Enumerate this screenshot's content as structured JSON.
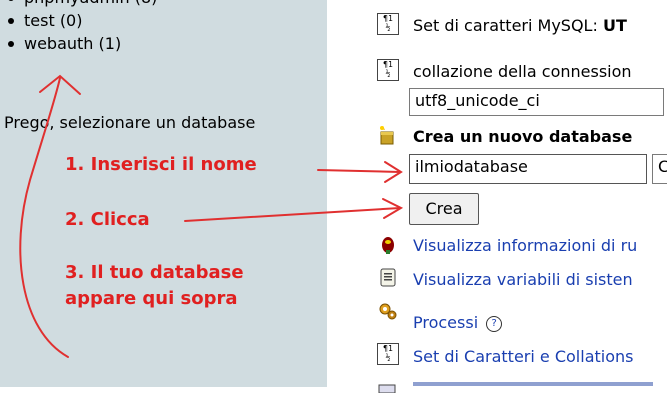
{
  "left_panel": {
    "databases": [
      {
        "name": "phpmyadmin (8)"
      },
      {
        "name": "test (0)"
      },
      {
        "name": "webauth (1)"
      }
    ],
    "prompt": "Prego, selezionare un database"
  },
  "annotations": {
    "step1": "1. Inserisci il nome",
    "step2": "2. Clicca",
    "step3_line1": "3. Il tuo database",
    "step3_line2": "appare qui sopra",
    "color": "#e02020"
  },
  "right_panel": {
    "charset_label": "Set di caratteri MySQL: ",
    "charset_value": "UT",
    "collation_label": "collazione della connession",
    "collation_value": "utf8_unicode_ci",
    "create_db_title": "Crea un nuovo database",
    "db_name_value": "ilmiodatabase",
    "collation_stub": "C",
    "create_button": "Crea",
    "links": {
      "server_info": "Visualizza informazioni di ru",
      "system_vars": "Visualizza variabili di sisten",
      "processes": "Processi",
      "charsets": "Set di Caratteri e Collations"
    },
    "icons": {
      "charset": "charset-icon",
      "create_db": "new-database-icon",
      "server_info": "status-icon",
      "variables": "variables-icon",
      "processes": "processes-icon",
      "help": "help-icon"
    },
    "link_color": "#1a3fb0"
  }
}
